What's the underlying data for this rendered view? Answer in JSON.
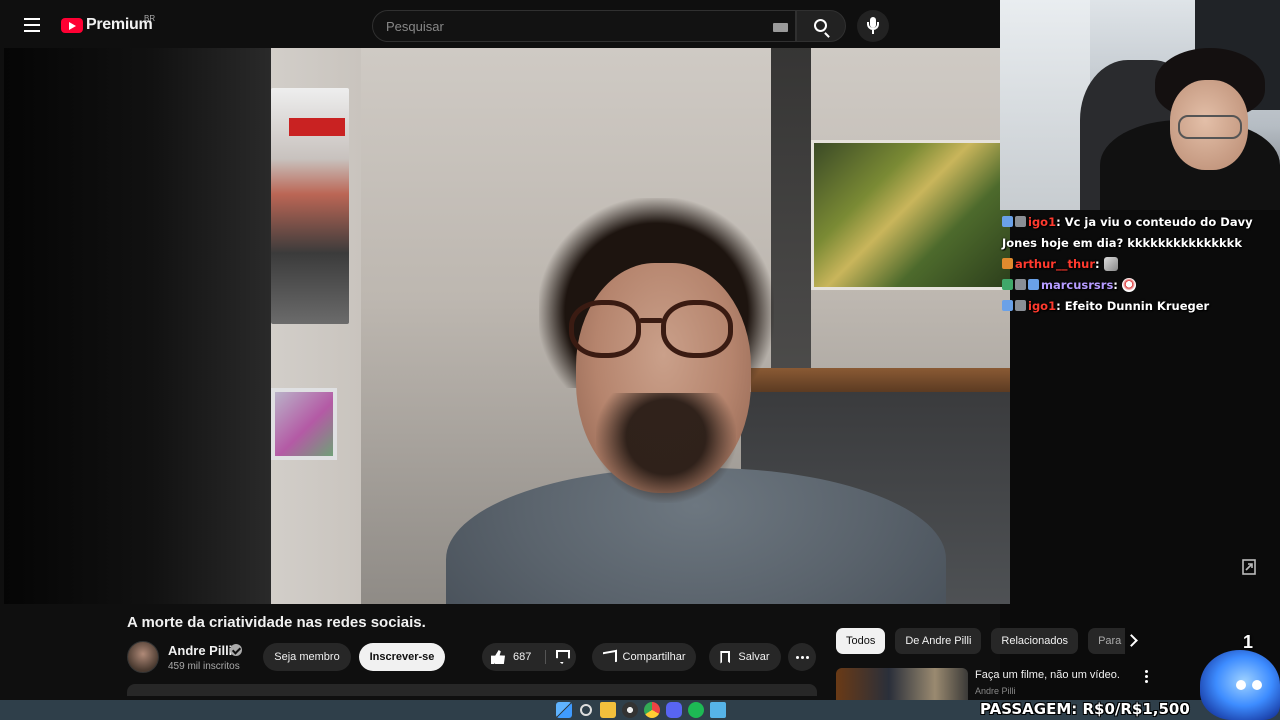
{
  "header": {
    "logo_text": "Premium",
    "country": "BR",
    "search_placeholder": "Pesquisar"
  },
  "video": {
    "title": "A morte da criatividade nas redes sociais.",
    "channel_name": "Andre Pilli",
    "subscribers": "459 mil inscritos",
    "join_label": "Seja membro",
    "subscribe_label": "Inscrever-se",
    "like_count": "687",
    "share_label": "Compartilhar",
    "save_label": "Salvar"
  },
  "sidebar": {
    "chips": [
      "Todos",
      "De Andre Pilli",
      "Relacionados",
      "Para"
    ],
    "recommendation": {
      "title": "Faça um filme, não um vídeo.",
      "channel": "Andre Pilli"
    }
  },
  "chat": {
    "messages": [
      {
        "user": "igo1",
        "text": "Vc ja viu o conteudo do Davy Jones hoje em dia? kkkkkkkkkkkkkkk"
      },
      {
        "user": "arthur__thur",
        "text": ""
      },
      {
        "user": "marcusrsrs",
        "text": ""
      },
      {
        "user": "igo1",
        "text": "Efeito Dunnin Krueger"
      }
    ]
  },
  "overlay": {
    "counter": "1",
    "passagem": "PASSAGEM: R$0/R$1,500"
  },
  "colors": {
    "yt_red": "#ff0033",
    "chat_user_red": "#ff3a2e",
    "chat_user_purple": "#b69cff",
    "taskbar": "#2f3f4a"
  }
}
